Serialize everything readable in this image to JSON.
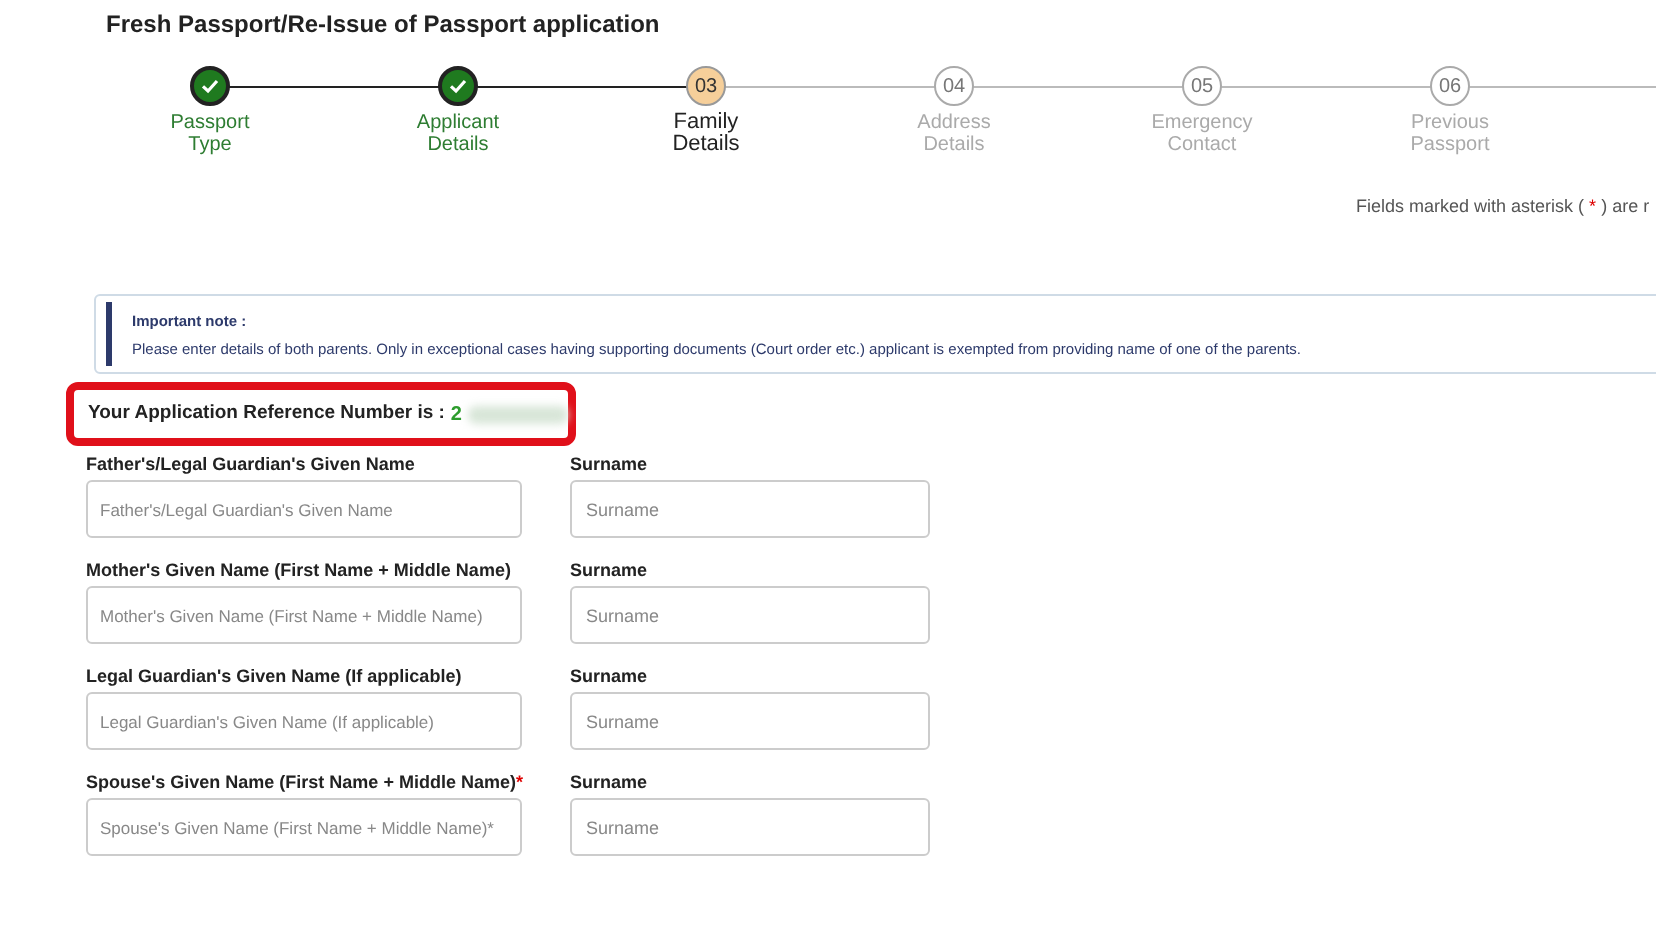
{
  "title": "Fresh Passport/Re-Issue of Passport application",
  "steps": [
    {
      "label": [
        "Passport",
        "Type"
      ],
      "completed": true,
      "selected": false
    },
    {
      "label": [
        "Applicant",
        "Details"
      ],
      "completed": true,
      "selected": false
    },
    {
      "number": "03",
      "label": [
        "Family",
        "Details"
      ],
      "completed": false,
      "selected": true
    },
    {
      "number": "04",
      "label": [
        "Address",
        "Details"
      ],
      "completed": false,
      "selected": false
    },
    {
      "number": "05",
      "label": [
        "Emergency",
        "Contact"
      ],
      "completed": false,
      "selected": false
    },
    {
      "number": "06",
      "label": [
        "Previous",
        "Passport"
      ],
      "completed": false,
      "selected": false
    }
  ],
  "required_hint": {
    "before": "Fields marked with asterisk (",
    "asterisk": "*",
    "after": ") are r"
  },
  "note": {
    "title": "Important note :",
    "text": "Please enter details of both parents. Only in exceptional cases having supporting documents (Court order etc.) applicant is exempted from providing name of one of the parents."
  },
  "reference": {
    "label": "Your Application Reference Number is :",
    "value": "2"
  },
  "fields": [
    {
      "label": "Father's/Legal Guardian's Given Name",
      "placeholder": "Father's/Legal Guardian's Given Name",
      "surname_label": "Surname",
      "surname_placeholder": "Surname"
    },
    {
      "label": "Mother's Given Name (First Name + Middle Name)",
      "placeholder": "Mother's Given Name (First Name + Middle Name)",
      "surname_label": "Surname",
      "surname_placeholder": "Surname"
    },
    {
      "label": "Legal Guardian's Given Name (If applicable)",
      "placeholder": "Legal Guardian's Given Name (If applicable)",
      "surname_label": "Surname",
      "surname_placeholder": "Surname"
    },
    {
      "label": "Spouse's Given Name (First Name + Middle Name)",
      "asterisk": "*",
      "placeholder": "Spouse's Given Name (First Name + Middle Name)*",
      "surname_label": "Surname",
      "surname_placeholder": "Surname"
    }
  ]
}
